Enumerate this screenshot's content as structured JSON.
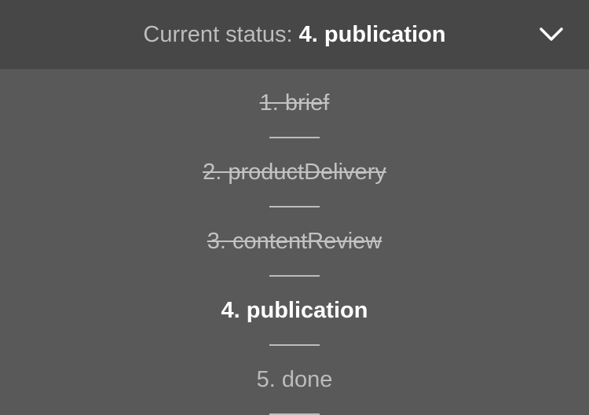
{
  "header": {
    "status_label": "Current status:",
    "status_value": "4. publication",
    "toggle_icon": "chevron-down-icon"
  },
  "steps": [
    {
      "label": "1. brief",
      "state": "done"
    },
    {
      "label": "2. productDelivery",
      "state": "done"
    },
    {
      "label": "3. contentReview",
      "state": "done"
    },
    {
      "label": "4. publication",
      "state": "current"
    },
    {
      "label": "5. done",
      "state": "upcoming"
    }
  ],
  "colors": {
    "header_background": "#474747",
    "panel_background": "#595959",
    "active_text": "#ffffff",
    "muted_text": "#bdbdbd"
  }
}
